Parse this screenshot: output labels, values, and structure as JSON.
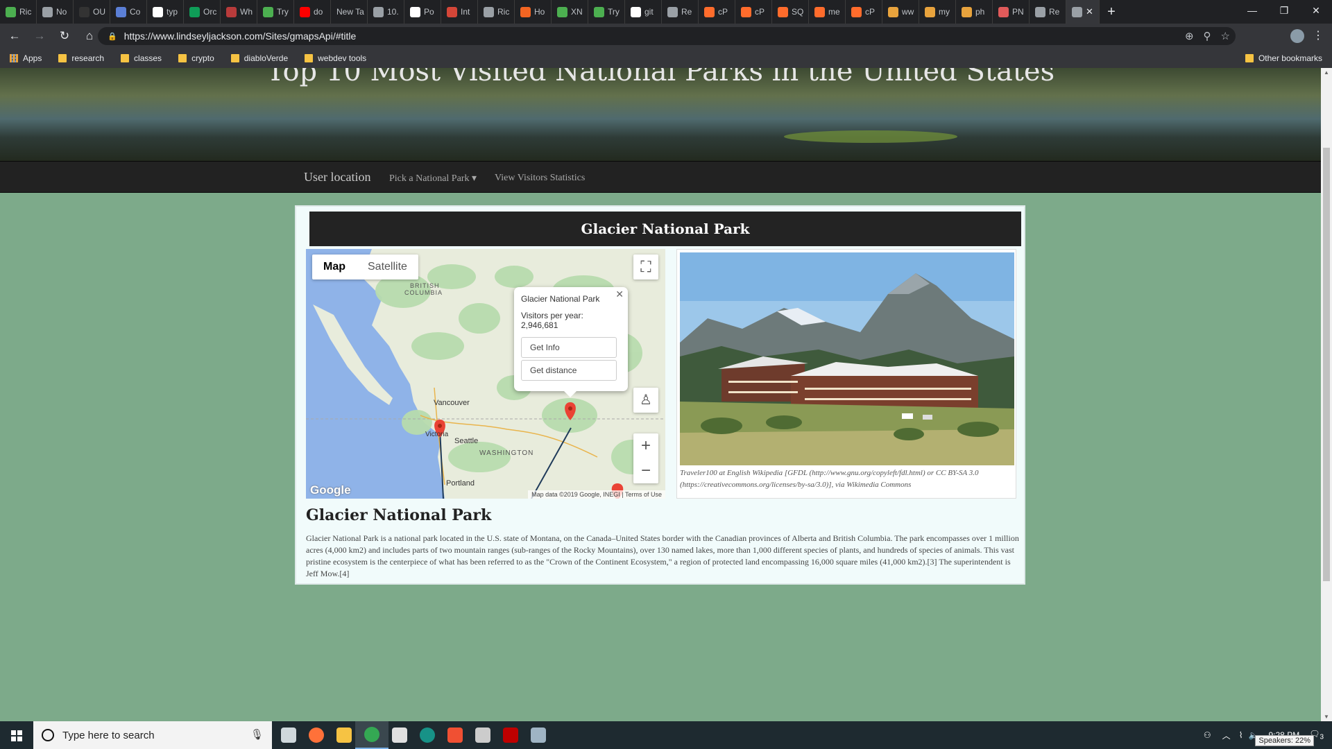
{
  "browser": {
    "tabs": [
      {
        "label": "Ric",
        "color": "#4caf50"
      },
      {
        "label": "No",
        "color": "#9aa0a6"
      },
      {
        "label": "OU",
        "color": "#333333"
      },
      {
        "label": "Co",
        "color": "#5b7fd6"
      },
      {
        "label": "typ",
        "color": "#ffffff"
      },
      {
        "label": "Orc",
        "color": "#0f9d58"
      },
      {
        "label": "Wh",
        "color": "#b83b3b"
      },
      {
        "label": "Try",
        "color": "#4caf50"
      },
      {
        "label": "do",
        "color": "#ff0000"
      },
      {
        "label": "New Ta",
        "color": ""
      },
      {
        "label": "10.",
        "color": "#9aa0a6"
      },
      {
        "label": "Po",
        "color": "#ffffff"
      },
      {
        "label": "Int",
        "color": "#d44638"
      },
      {
        "label": "Ric",
        "color": "#9aa0a6"
      },
      {
        "label": "Ho",
        "color": "#f26522"
      },
      {
        "label": "XN",
        "color": "#4caf50"
      },
      {
        "label": "Try",
        "color": "#4caf50"
      },
      {
        "label": "git",
        "color": "#ffffff"
      },
      {
        "label": "Re",
        "color": "#9aa0a6"
      },
      {
        "label": "cP",
        "color": "#ff6c2c"
      },
      {
        "label": "cP",
        "color": "#ff6c2c"
      },
      {
        "label": "SQ",
        "color": "#ff6c2c"
      },
      {
        "label": "me",
        "color": "#ff6c2c"
      },
      {
        "label": "cP",
        "color": "#ff6c2c"
      },
      {
        "label": "ww",
        "color": "#e8a33d"
      },
      {
        "label": "my",
        "color": "#e8a33d"
      },
      {
        "label": "ph",
        "color": "#e8a33d"
      },
      {
        "label": "PN",
        "color": "#e05a5a"
      },
      {
        "label": "Re",
        "color": "#9aa0a6"
      }
    ],
    "active_tab_close": "✕",
    "new_tab": "+",
    "window_controls": {
      "minimize": "—",
      "maximize": "❐",
      "close": "✕"
    },
    "url": "https://www.lindseyljackson.com/Sites/gmapsApi/#title",
    "bookmarks": [
      {
        "label": "Apps",
        "icon": "apps-grid-icon"
      },
      {
        "label": "research",
        "icon": "folder-icon"
      },
      {
        "label": "classes",
        "icon": "folder-icon"
      },
      {
        "label": "crypto",
        "icon": "folder-icon"
      },
      {
        "label": "diabloVerde",
        "icon": "folder-icon"
      },
      {
        "label": "webdev tools",
        "icon": "folder-icon"
      }
    ],
    "other_bookmarks": "Other bookmarks"
  },
  "page": {
    "hero_title": "Top 10 Most Visited National Parks in the United States",
    "nav": {
      "brand": "User location",
      "pick_park": "Pick a National Park ▾",
      "stats": "View Visitors Statistics"
    },
    "card_title": "Glacier National Park",
    "map": {
      "type_map": "Map",
      "type_satellite": "Satellite",
      "labels": {
        "bc": "BRITISH",
        "bc2": "COLUMBIA",
        "vancouver": "Vancouver",
        "victoria": "Victoria",
        "seattle": "Seattle",
        "washington": "WASHINGTON",
        "portland": "Portland"
      },
      "google": "Google",
      "attribution": "Map data ©2019 Google, INEGI",
      "terms": "Terms of Use",
      "infowindow": {
        "title": "Glacier National Park",
        "visitors": "Visitors per year: 2,946,681",
        "get_info": "Get Info",
        "get_distance": "Get distance"
      }
    },
    "photo_caption": "Traveler100 at English Wikipedia [GFDL (http://www.gnu.org/copyleft/fdl.html) or CC BY-SA 3.0 (https://creativecommons.org/licenses/by-sa/3.0)], via Wikimedia Commons",
    "park_name": "Glacier National Park",
    "park_description": "Glacier National Park is a national park located in the U.S. state of Montana, on the Canada–United States border with the Canadian provinces of Alberta and British Columbia. The park encompasses over 1 million acres (4,000 km2) and includes parts of two mountain ranges (sub-ranges of the Rocky Mountains), over 130 named lakes, more than 1,000 different species of plants, and hundreds of species of animals. This vast pristine ecosystem is the centerpiece of what has been referred to as the \"Crown of the Continent Ecosystem,\" a region of protected land encompassing 16,000 square miles (41,000 km2).[3] The superintendent is Jeff Mow.[4]"
  },
  "taskbar": {
    "search_placeholder": "Type here to search",
    "clock_time": "9:28 PM",
    "speaker_tip": "Speakers: 22%",
    "notif_count": "3",
    "apps": [
      {
        "name": "task-view-icon",
        "color": "#cfd8dc"
      },
      {
        "name": "firefox-icon",
        "color": "#ff7139"
      },
      {
        "name": "file-explorer-icon",
        "color": "#f6c343"
      },
      {
        "name": "chrome-icon",
        "color": "#34a853"
      },
      {
        "name": "obs-icon",
        "color": "#e0e0e0"
      },
      {
        "name": "gitkraken-icon",
        "color": "#179287"
      },
      {
        "name": "git-icon",
        "color": "#f05033"
      },
      {
        "name": "inkscape-icon",
        "color": "#cccccc"
      },
      {
        "name": "filezilla-icon",
        "color": "#bf0000"
      },
      {
        "name": "photos-icon",
        "color": "#9fb4c4"
      }
    ]
  }
}
